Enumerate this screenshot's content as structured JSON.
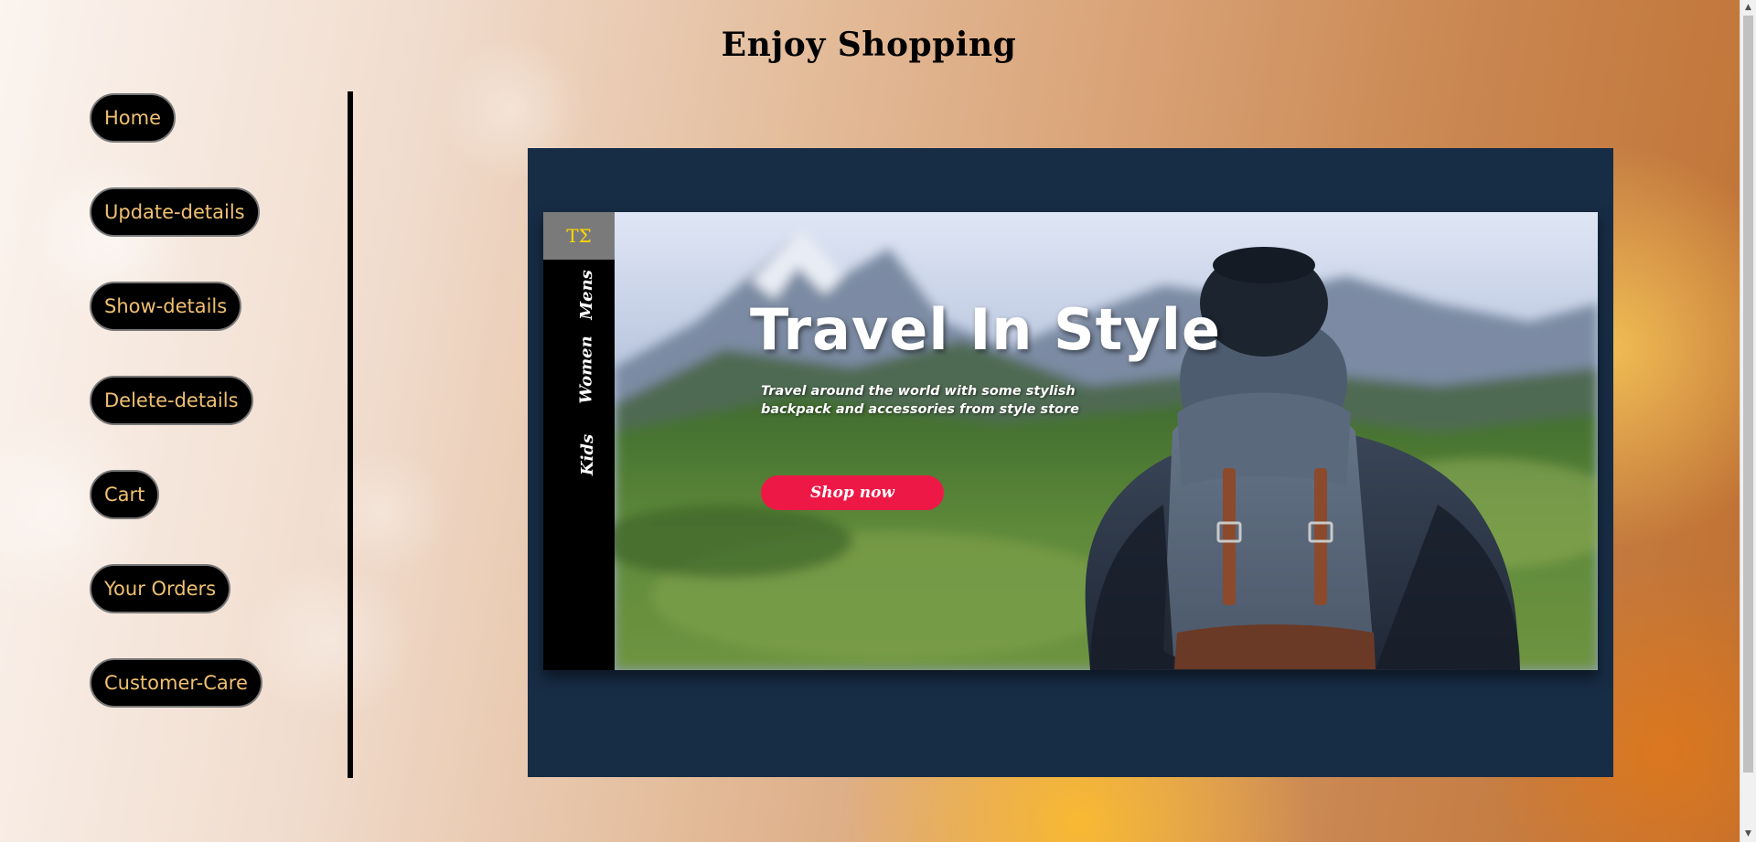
{
  "header": {
    "title": "Enjoy Shopping"
  },
  "sidebar": {
    "items": [
      {
        "label": "Home",
        "name": "home"
      },
      {
        "label": "Update-details",
        "name": "update-details"
      },
      {
        "label": "Show-details",
        "name": "show-details"
      },
      {
        "label": "Delete-details",
        "name": "delete-details"
      },
      {
        "label": "Cart",
        "name": "cart"
      },
      {
        "label": "Your Orders",
        "name": "your-orders"
      },
      {
        "label": "Customer-Care",
        "name": "customer-care"
      }
    ]
  },
  "banner": {
    "logo": "TΣ",
    "nav_items": [
      "Mens",
      "Women",
      "Kids"
    ],
    "heading": "Travel In Style",
    "description": "Travel around the world with some stylish backpack and accessories from style store",
    "cta_label": "Shop now"
  },
  "colors": {
    "banner_background": "#172c45",
    "cta": "#ee1846",
    "nav_button_text": "#f0c070",
    "logo_text": "#ffd700"
  },
  "scrollbar": {
    "up_icon": "triangle-up",
    "down_icon": "triangle-down"
  }
}
